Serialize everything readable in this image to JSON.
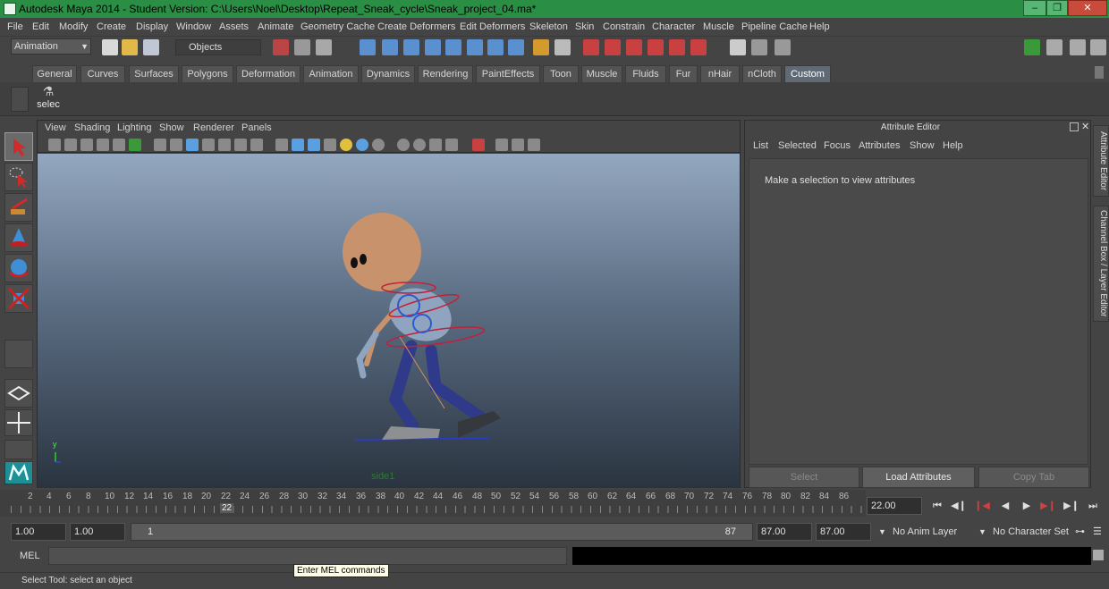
{
  "window": {
    "title": "Autodesk Maya 2014 - Student Version: C:\\Users\\Noel\\Desktop\\Repeat_Sneak_cycle\\Sneak_project_04.ma*",
    "minimize_icon": "minimize-icon",
    "restore_icon": "restore-icon",
    "close_icon": "close-icon"
  },
  "menubar": {
    "items": [
      "File",
      "Edit",
      "Modify",
      "Create",
      "Display",
      "Window",
      "Assets",
      "Animate",
      "Geometry Cache",
      "Create Deformers",
      "Edit Deformers",
      "Skeleton",
      "Skin",
      "Constrain",
      "Character",
      "Muscle",
      "Pipeline Cache",
      "Help"
    ]
  },
  "statusline": {
    "mode": "Animation",
    "selection_mode": "Objects"
  },
  "shelf": {
    "tabs": [
      "General",
      "Curves",
      "Surfaces",
      "Polygons",
      "Deformation",
      "Animation",
      "Dynamics",
      "Rendering",
      "PaintEffects",
      "Toon",
      "Muscle",
      "Fluids",
      "Fur",
      "nHair",
      "nCloth",
      "Custom"
    ],
    "active_tab": "Custom",
    "button_label": "selec"
  },
  "viewport": {
    "menu": [
      "View",
      "Shading",
      "Lighting",
      "Show",
      "Renderer",
      "Panels"
    ],
    "camera_label": "side1",
    "axis_label": "y"
  },
  "attribute_editor": {
    "title": "Attribute Editor",
    "menu": [
      "List",
      "Selected",
      "Focus",
      "Attributes",
      "Show",
      "Help"
    ],
    "message": "Make a selection to view attributes",
    "buttons": {
      "select": "Select",
      "load": "Load Attributes",
      "copy": "Copy Tab"
    },
    "side_tabs": [
      "Attribute Editor",
      "Channel Box / Layer Editor"
    ]
  },
  "timeline": {
    "ticks": [
      "2",
      "4",
      "6",
      "8",
      "10",
      "12",
      "14",
      "16",
      "18",
      "20",
      "22",
      "24",
      "26",
      "28",
      "30",
      "32",
      "34",
      "36",
      "38",
      "40",
      "42",
      "44",
      "46",
      "48",
      "50",
      "52",
      "54",
      "56",
      "58",
      "60",
      "62",
      "64",
      "66",
      "68",
      "70",
      "72",
      "74",
      "76",
      "78",
      "80",
      "82",
      "84",
      "86"
    ],
    "current_frame": "22",
    "current_time": "22.00"
  },
  "range": {
    "start_time": "1.00",
    "playback_start": "1.00",
    "slider_start": "1",
    "slider_end": "87",
    "playback_end": "87.00",
    "end_time": "87.00",
    "anim_layer": "No Anim Layer",
    "character_set": "No Character Set"
  },
  "command": {
    "label": "MEL",
    "tooltip": "Enter MEL commands"
  },
  "help_line": "Select Tool: select an object",
  "colors": {
    "titlebar": "#2a8f45",
    "ui_bg": "#444444",
    "active_shelf_tab": "#5f6a75",
    "character_head": "#c8926c",
    "character_body": "#8fa5bf",
    "character_limbs": "#2f3a8a",
    "control_curve": "#c0203a"
  }
}
